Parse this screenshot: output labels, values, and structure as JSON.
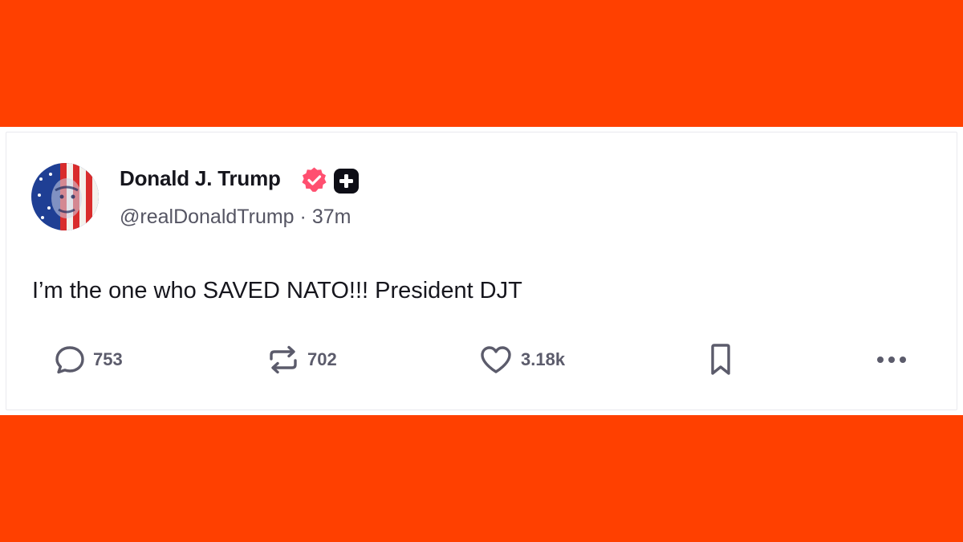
{
  "colors": {
    "band": "#ff4000",
    "card_bg": "#ffffff",
    "verified_badge": "#ff4f70",
    "plus_badge": "#0e0e16",
    "name_text": "#16161d",
    "meta_text": "#555563",
    "action_icon": "#5b5b6b"
  },
  "post": {
    "author": {
      "display_name": "Donald J. Trump",
      "handle": "@realDonaldTrump",
      "separator": "·",
      "time_ago": "37m",
      "avatar_icon": "flag-portrait-avatar",
      "verified_icon": "verified-badge-icon",
      "subscription_icon": "plus-badge-icon"
    },
    "text": "I’m the one who SAVED NATO!!! President DJT",
    "actions": {
      "replies": {
        "icon": "reply-icon",
        "count": "753"
      },
      "reposts": {
        "icon": "repost-icon",
        "count": "702"
      },
      "likes": {
        "icon": "heart-icon",
        "count": "3.18k"
      },
      "bookmark": {
        "icon": "bookmark-icon"
      },
      "more": {
        "icon": "more-options-icon"
      }
    }
  }
}
